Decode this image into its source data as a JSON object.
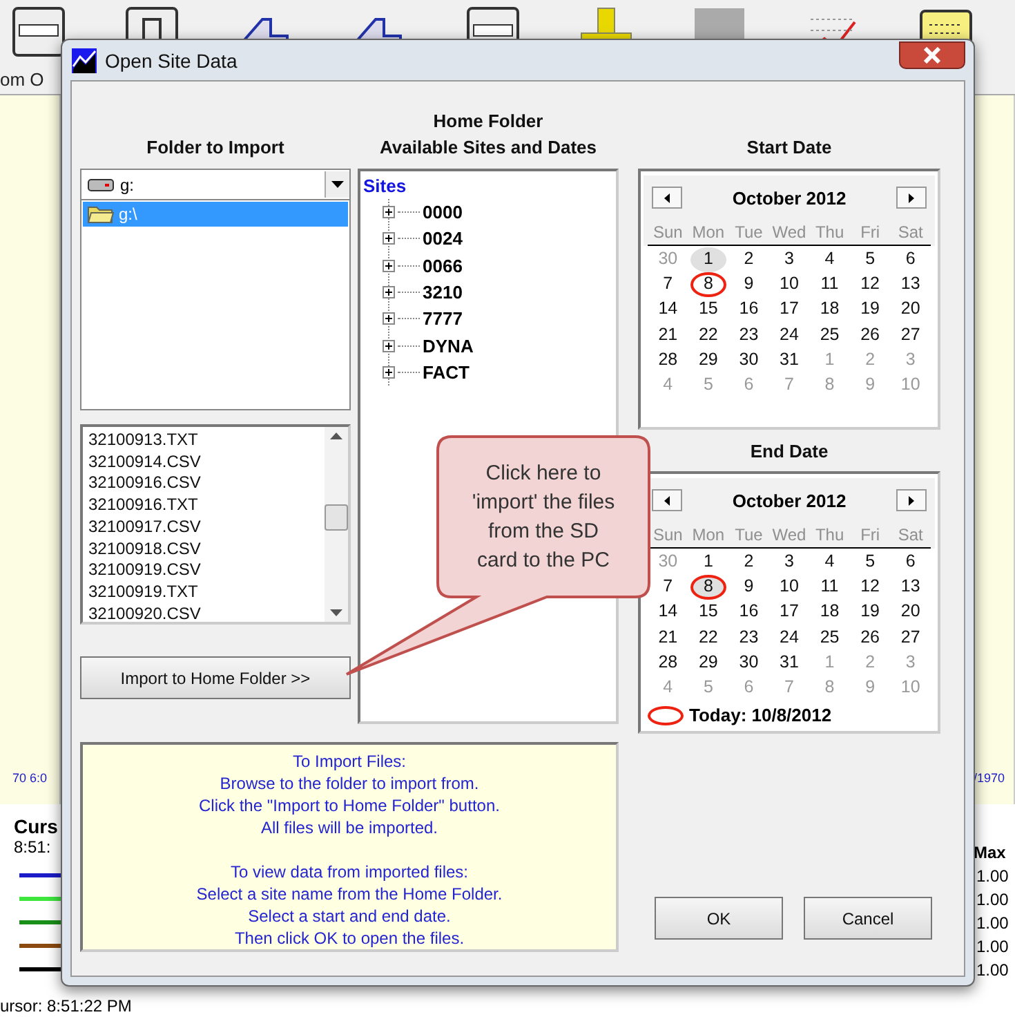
{
  "background_app": {
    "toolbar": [
      {
        "kind": "window"
      },
      {
        "kind": "step"
      },
      {
        "kind": "arrow"
      },
      {
        "kind": "arrow"
      },
      {
        "kind": "window"
      },
      {
        "kind": "ruler"
      },
      {
        "kind": "block"
      },
      {
        "kind": "chart"
      },
      {
        "kind": "note"
      }
    ],
    "toolbar_label": "om O",
    "axis_labels": [
      "70 6:0",
      "/1970"
    ],
    "legend": {
      "heading": "Curs",
      "time": "8:51:",
      "lines": [
        {
          "color": "#1c1cc8"
        },
        {
          "color": "#3ee63e"
        },
        {
          "color": "#1a8f1a"
        },
        {
          "color": "#8b4a10"
        },
        {
          "color": "#000000"
        }
      ]
    },
    "max_column": {
      "heading": "Max",
      "values": [
        "1.00",
        "1.00",
        "1.00",
        "1.00",
        "1.00"
      ]
    },
    "status_bar": "ursor: 8:51:22 PM"
  },
  "dialog": {
    "title": "Open Site Data",
    "import_panel": {
      "heading": "Folder to Import",
      "drive": "g:",
      "folders": [
        {
          "label": "g:\\",
          "selected": true
        }
      ],
      "files": [
        "32100913.TXT",
        "32100914.CSV",
        "32100916.CSV",
        "32100916.TXT",
        "32100917.CSV",
        "32100918.CSV",
        "32100919.CSV",
        "32100919.TXT",
        "32100920.CSV"
      ],
      "button": "Import to Home Folder >>"
    },
    "home_panel": {
      "heading": "Home Folder\nAvailable Sites and Dates",
      "tree": {
        "label": "Sites",
        "children": [
          {
            "label": "0000",
            "expanded": false
          },
          {
            "label": "0024",
            "expanded": false
          },
          {
            "label": "0066",
            "expanded": false
          },
          {
            "label": "3210",
            "expanded": false
          },
          {
            "label": "7777",
            "expanded": false
          },
          {
            "label": "DYNA",
            "expanded": false
          },
          {
            "label": "FACT",
            "expanded": false
          }
        ]
      }
    },
    "start_date": {
      "heading": "Start Date",
      "month": "October 2012",
      "weekdays": [
        "Sun",
        "Mon",
        "Tue",
        "Wed",
        "Thu",
        "Fri",
        "Sat"
      ],
      "days": [
        {
          "day": "30",
          "muted": true,
          "selected": false,
          "today": false
        },
        {
          "day": "1",
          "muted": false,
          "selected": true,
          "today": false
        },
        {
          "day": "2",
          "muted": false,
          "selected": false,
          "today": false
        },
        {
          "day": "3",
          "muted": false,
          "selected": false,
          "today": false
        },
        {
          "day": "4",
          "muted": false,
          "selected": false,
          "today": false
        },
        {
          "day": "5",
          "muted": false,
          "selected": false,
          "today": false
        },
        {
          "day": "6",
          "muted": false,
          "selected": false,
          "today": false
        },
        {
          "day": "7",
          "muted": false,
          "selected": false,
          "today": false
        },
        {
          "day": "8",
          "muted": false,
          "selected": false,
          "today": true
        },
        {
          "day": "9",
          "muted": false,
          "selected": false,
          "today": false
        },
        {
          "day": "10",
          "muted": false,
          "selected": false,
          "today": false
        },
        {
          "day": "11",
          "muted": false,
          "selected": false,
          "today": false
        },
        {
          "day": "12",
          "muted": false,
          "selected": false,
          "today": false
        },
        {
          "day": "13",
          "muted": false,
          "selected": false,
          "today": false
        },
        {
          "day": "14",
          "muted": false,
          "selected": false,
          "today": false
        },
        {
          "day": "15",
          "muted": false,
          "selected": false,
          "today": false
        },
        {
          "day": "16",
          "muted": false,
          "selected": false,
          "today": false
        },
        {
          "day": "17",
          "muted": false,
          "selected": false,
          "today": false
        },
        {
          "day": "18",
          "muted": false,
          "selected": false,
          "today": false
        },
        {
          "day": "19",
          "muted": false,
          "selected": false,
          "today": false
        },
        {
          "day": "20",
          "muted": false,
          "selected": false,
          "today": false
        },
        {
          "day": "21",
          "muted": false,
          "selected": false,
          "today": false
        },
        {
          "day": "22",
          "muted": false,
          "selected": false,
          "today": false
        },
        {
          "day": "23",
          "muted": false,
          "selected": false,
          "today": false
        },
        {
          "day": "24",
          "muted": false,
          "selected": false,
          "today": false
        },
        {
          "day": "25",
          "muted": false,
          "selected": false,
          "today": false
        },
        {
          "day": "26",
          "muted": false,
          "selected": false,
          "today": false
        },
        {
          "day": "27",
          "muted": false,
          "selected": false,
          "today": false
        },
        {
          "day": "28",
          "muted": false,
          "selected": false,
          "today": false
        },
        {
          "day": "29",
          "muted": false,
          "selected": false,
          "today": false
        },
        {
          "day": "30",
          "muted": false,
          "selected": false,
          "today": false
        },
        {
          "day": "31",
          "muted": false,
          "selected": false,
          "today": false
        },
        {
          "day": "1",
          "muted": true,
          "selected": false,
          "today": false
        },
        {
          "day": "2",
          "muted": true,
          "selected": false,
          "today": false
        },
        {
          "day": "3",
          "muted": true,
          "selected": false,
          "today": false
        },
        {
          "day": "4",
          "muted": true,
          "selected": false,
          "today": false
        },
        {
          "day": "5",
          "muted": true,
          "selected": false,
          "today": false
        },
        {
          "day": "6",
          "muted": true,
          "selected": false,
          "today": false
        },
        {
          "day": "7",
          "muted": true,
          "selected": false,
          "today": false
        },
        {
          "day": "8",
          "muted": true,
          "selected": false,
          "today": false
        },
        {
          "day": "9",
          "muted": true,
          "selected": false,
          "today": false
        },
        {
          "day": "10",
          "muted": true,
          "selected": false,
          "today": false
        }
      ]
    },
    "end_date": {
      "heading": "End Date",
      "month": "October 2012",
      "weekdays": [
        "Sun",
        "Mon",
        "Tue",
        "Wed",
        "Thu",
        "Fri",
        "Sat"
      ],
      "days": [
        {
          "day": "30",
          "muted": true,
          "selected": false,
          "today": false
        },
        {
          "day": "1",
          "muted": false,
          "selected": false,
          "today": false
        },
        {
          "day": "2",
          "muted": false,
          "selected": false,
          "today": false
        },
        {
          "day": "3",
          "muted": false,
          "selected": false,
          "today": false
        },
        {
          "day": "4",
          "muted": false,
          "selected": false,
          "today": false
        },
        {
          "day": "5",
          "muted": false,
          "selected": false,
          "today": false
        },
        {
          "day": "6",
          "muted": false,
          "selected": false,
          "today": false
        },
        {
          "day": "7",
          "muted": false,
          "selected": false,
          "today": false
        },
        {
          "day": "8",
          "muted": false,
          "selected": true,
          "today": true
        },
        {
          "day": "9",
          "muted": false,
          "selected": false,
          "today": false
        },
        {
          "day": "10",
          "muted": false,
          "selected": false,
          "today": false
        },
        {
          "day": "11",
          "muted": false,
          "selected": false,
          "today": false
        },
        {
          "day": "12",
          "muted": false,
          "selected": false,
          "today": false
        },
        {
          "day": "13",
          "muted": false,
          "selected": false,
          "today": false
        },
        {
          "day": "14",
          "muted": false,
          "selected": false,
          "today": false
        },
        {
          "day": "15",
          "muted": false,
          "selected": false,
          "today": false
        },
        {
          "day": "16",
          "muted": false,
          "selected": false,
          "today": false
        },
        {
          "day": "17",
          "muted": false,
          "selected": false,
          "today": false
        },
        {
          "day": "18",
          "muted": false,
          "selected": false,
          "today": false
        },
        {
          "day": "19",
          "muted": false,
          "selected": false,
          "today": false
        },
        {
          "day": "20",
          "muted": false,
          "selected": false,
          "today": false
        },
        {
          "day": "21",
          "muted": false,
          "selected": false,
          "today": false
        },
        {
          "day": "22",
          "muted": false,
          "selected": false,
          "today": false
        },
        {
          "day": "23",
          "muted": false,
          "selected": false,
          "today": false
        },
        {
          "day": "24",
          "muted": false,
          "selected": false,
          "today": false
        },
        {
          "day": "25",
          "muted": false,
          "selected": false,
          "today": false
        },
        {
          "day": "26",
          "muted": false,
          "selected": false,
          "today": false
        },
        {
          "day": "27",
          "muted": false,
          "selected": false,
          "today": false
        },
        {
          "day": "28",
          "muted": false,
          "selected": false,
          "today": false
        },
        {
          "day": "29",
          "muted": false,
          "selected": false,
          "today": false
        },
        {
          "day": "30",
          "muted": false,
          "selected": false,
          "today": false
        },
        {
          "day": "31",
          "muted": false,
          "selected": false,
          "today": false
        },
        {
          "day": "1",
          "muted": true,
          "selected": false,
          "today": false
        },
        {
          "day": "2",
          "muted": true,
          "selected": false,
          "today": false
        },
        {
          "day": "3",
          "muted": true,
          "selected": false,
          "today": false
        },
        {
          "day": "4",
          "muted": true,
          "selected": false,
          "today": false
        },
        {
          "day": "5",
          "muted": true,
          "selected": false,
          "today": false
        },
        {
          "day": "6",
          "muted": true,
          "selected": false,
          "today": false
        },
        {
          "day": "7",
          "muted": true,
          "selected": false,
          "today": false
        },
        {
          "day": "8",
          "muted": true,
          "selected": false,
          "today": false
        },
        {
          "day": "9",
          "muted": true,
          "selected": false,
          "today": false
        },
        {
          "day": "10",
          "muted": true,
          "selected": false,
          "today": false
        }
      ],
      "today_label": "Today: 10/8/2012"
    },
    "help": [
      "To Import Files:\nBrowse to the folder to import from.\nClick the \"Import to Home Folder\" button.\nAll files will be imported.",
      "To view data from imported files:\nSelect a site name from the Home Folder.\nSelect a start and end date.\nThen click OK to open the files."
    ],
    "callout": "Click here to\n'import' the files\nfrom the SD\ncard to the PC",
    "buttons": [
      "OK",
      "Cancel"
    ]
  }
}
